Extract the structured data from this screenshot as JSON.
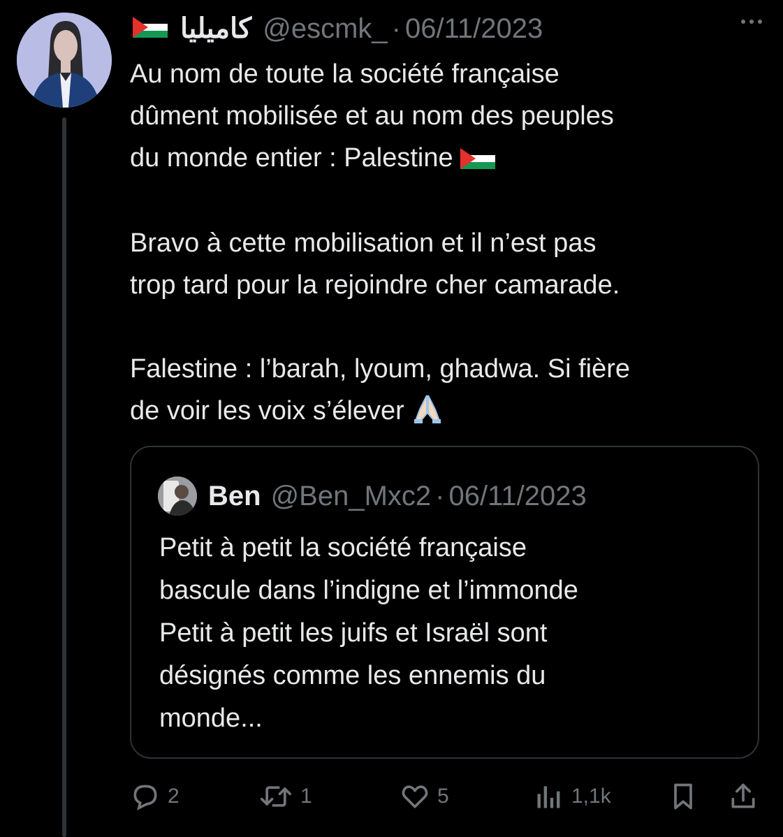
{
  "tweet": {
    "display_name": "كاميليا",
    "handle": "@escmk_",
    "separator": "·",
    "date": "06/11/2023",
    "paragraphs": [
      [
        "Au nom de toute la société française",
        "dûment mobilisée et au nom des peuples",
        "du monde entier : Palestine"
      ],
      [
        "Bravo à cette mobilisation et il n’est pas",
        "trop tard pour la rejoindre cher camarade."
      ],
      [
        "Falestine : l’barah, lyoum, ghadwa. Si fière",
        "de voir les voix s’élever"
      ]
    ]
  },
  "quote": {
    "display_name": "Ben",
    "handle": "@Ben_Mxc2",
    "separator": "·",
    "date": "06/11/2023",
    "lines": [
      "Petit à petit la société française",
      "bascule dans l’indigne et l’immonde",
      "Petit à petit les juifs et Israël sont",
      "désignés comme les ennemis du",
      "monde..."
    ]
  },
  "actions": {
    "replies": "2",
    "reposts": "1",
    "likes": "5",
    "views": "1,1k"
  },
  "icons": {
    "reply": "reply-icon",
    "repost": "repost-icon",
    "like": "heart-icon",
    "views": "views-icon",
    "bookmark": "bookmark-icon",
    "share": "share-icon",
    "more": "more-icon",
    "flag": "palestine-flag-icon",
    "pray": "folded-hands-icon"
  },
  "colors": {
    "background": "#000000",
    "text": "#e7e9ea",
    "muted": "#71767b",
    "border": "#2f3336"
  }
}
